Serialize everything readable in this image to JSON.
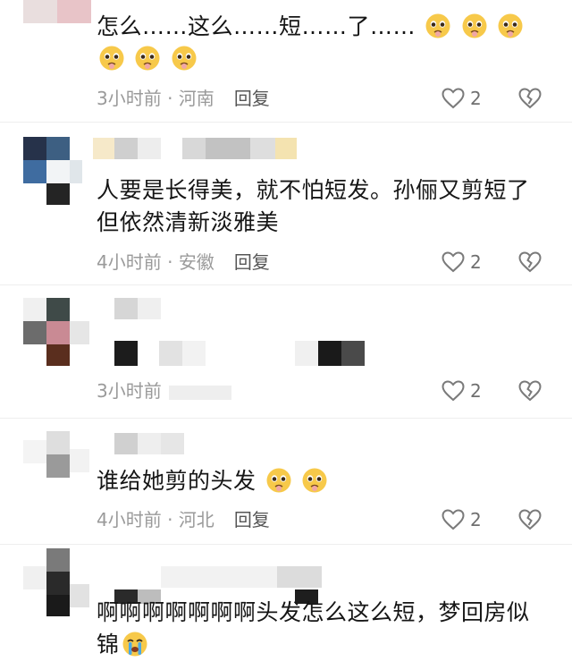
{
  "comments": [
    {
      "text": "怎么……这么……短……了……",
      "emoji": "pleading-face",
      "emoji_count": 6,
      "time": "3小时前",
      "location": "河南",
      "reply_label": "回复",
      "likes": "2"
    },
    {
      "text": "人要是长得美，就不怕短发。孙俪又剪短了但依然清新淡雅美",
      "time": "4小时前",
      "location": "安徽",
      "reply_label": "回复",
      "likes": "2"
    },
    {
      "time": "3小时前",
      "likes": "2"
    },
    {
      "text": "谁给她剪的头发",
      "emoji": "pleading-face",
      "emoji_count": 2,
      "time": "4小时前",
      "location": "河北",
      "reply_label": "回复",
      "likes": "2"
    },
    {
      "text": "啊啊啊啊啊啊啊头发怎么这么短，梦回房似锦",
      "emoji": "crying-face"
    }
  ],
  "separator": " · ",
  "colors": {
    "like_icon": "#7a7a7a",
    "meta_text": "#9a9a9a",
    "emoji_face": "#f7c94a"
  }
}
